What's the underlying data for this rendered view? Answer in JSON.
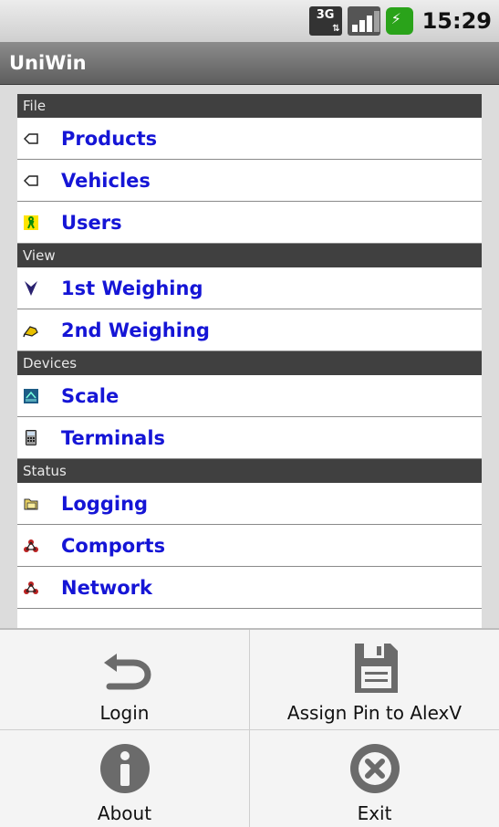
{
  "status_bar": {
    "network_label": "3G",
    "time": "15:29"
  },
  "app": {
    "title": "UniWin"
  },
  "sections": [
    {
      "header": "File",
      "items": [
        {
          "label": "Products",
          "icon": "tag-icon"
        },
        {
          "label": "Vehicles",
          "icon": "tag-icon"
        },
        {
          "label": "Users",
          "icon": "user-icon"
        }
      ]
    },
    {
      "header": "View",
      "items": [
        {
          "label": "1st Weighing",
          "icon": "arrow-down-icon"
        },
        {
          "label": "2nd Weighing",
          "icon": "hand-icon"
        }
      ]
    },
    {
      "header": "Devices",
      "items": [
        {
          "label": "Scale",
          "icon": "scale-icon"
        },
        {
          "label": "Terminals",
          "icon": "terminal-icon"
        }
      ]
    },
    {
      "header": "Status",
      "items": [
        {
          "label": "Logging",
          "icon": "folder-icon"
        },
        {
          "label": "Comports",
          "icon": "network-icon"
        },
        {
          "label": "Network",
          "icon": "network-icon"
        }
      ]
    }
  ],
  "menu": {
    "login": "Login",
    "assign_pin": "Assign Pin to AlexV",
    "about": "About",
    "exit": "Exit"
  }
}
